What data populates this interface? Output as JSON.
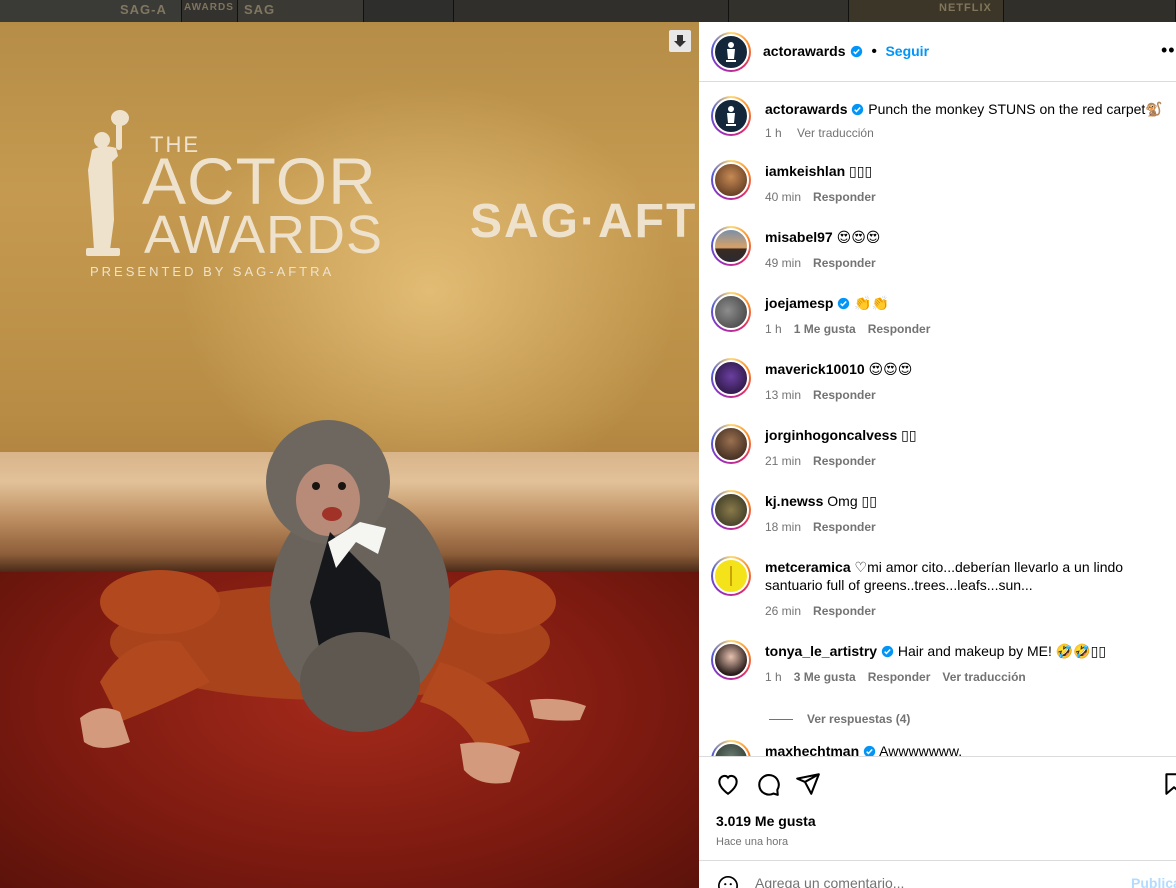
{
  "background_strip": {
    "tiles": [
      "SAG-A",
      "AWARDS",
      "SAG",
      "",
      "",
      "",
      "NETFLIX",
      ""
    ]
  },
  "media": {
    "logo_the": "THE",
    "logo_actor": "ACTOR",
    "logo_awards": "AWARDS",
    "logo_presented": "PRESENTED BY SAG-AFTRA",
    "wall_text": "SAG·AFT"
  },
  "header": {
    "username": "actorawards",
    "separator": "•",
    "follow_label": "Seguir",
    "more_icon": "more-horizontal-icon"
  },
  "caption": {
    "username": "actorawards",
    "text": "Punch the monkey STUNS on the red carpet🐒",
    "time": "1 h",
    "translate": "Ver traducción"
  },
  "comments": [
    {
      "username": "iamkeishlan",
      "verified": false,
      "text": "▯▯▯",
      "time": "40 min",
      "likes": "",
      "reply": "Responder",
      "translate": ""
    },
    {
      "username": "misabel97",
      "verified": false,
      "text": "😍😍😍",
      "time": "49 min",
      "likes": "",
      "reply": "Responder",
      "translate": ""
    },
    {
      "username": "joejamesp",
      "verified": true,
      "text": "👏👏",
      "time": "1 h",
      "likes": "1 Me gusta",
      "reply": "Responder",
      "translate": ""
    },
    {
      "username": "maverick10010",
      "verified": false,
      "text": "😍😍😍",
      "time": "13 min",
      "likes": "",
      "reply": "Responder",
      "translate": ""
    },
    {
      "username": "jorginhogoncalvess",
      "verified": false,
      "text": "▯▯",
      "time": "21 min",
      "likes": "",
      "reply": "Responder",
      "translate": ""
    },
    {
      "username": "kj.newss",
      "verified": false,
      "text": "Omg ▯▯",
      "time": "18 min",
      "likes": "",
      "reply": "Responder",
      "translate": ""
    },
    {
      "username": "metceramica",
      "verified": false,
      "text": "♡mi amor cito...deberían llevarlo a un lindo santuario full of greens..trees...leafs...sun...",
      "time": "26 min",
      "likes": "",
      "reply": "Responder",
      "translate": ""
    },
    {
      "username": "tonya_le_artistry",
      "verified": true,
      "text": "Hair and makeup by ME! 🤣🤣▯▯",
      "time": "1 h",
      "likes": "3 Me gusta",
      "reply": "Responder",
      "translate": "Ver traducción"
    },
    {
      "username": "maxhechtman",
      "verified": true,
      "text": "Awwwwwww.",
      "time": "",
      "likes": "",
      "reply": "",
      "translate": ""
    }
  ],
  "view_replies": "Ver respuestas (4)",
  "actions": {
    "like_icon": "heart-icon",
    "comment_icon": "comment-icon",
    "share_icon": "send-icon",
    "save_icon": "bookmark-icon",
    "likes_count": "3.019 Me gusta",
    "posted": "Hace una hora"
  },
  "add_comment": {
    "placeholder": "Agrega un comentario...",
    "publish": "Publicar"
  },
  "colors": {
    "link": "#0095f6",
    "verified": "#0095f6",
    "muted": "#737373"
  }
}
